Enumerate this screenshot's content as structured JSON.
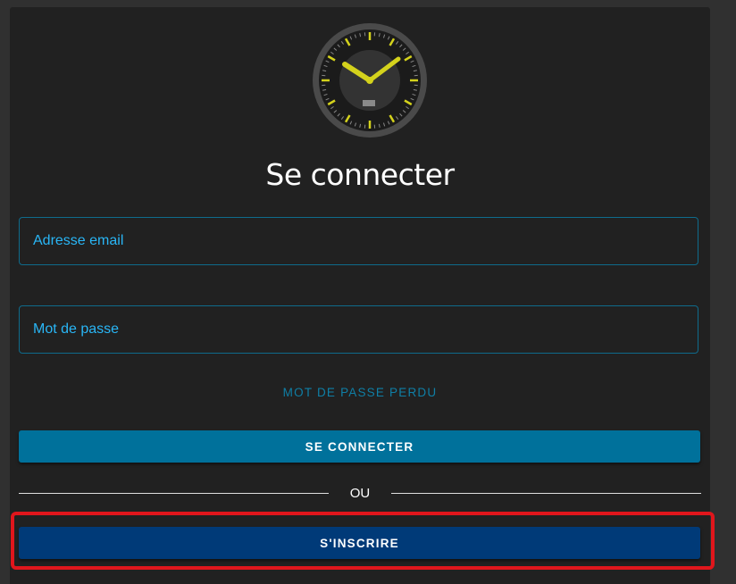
{
  "logo": {
    "icon": "clock-icon",
    "accent_color": "#d4d21c"
  },
  "title": "Se connecter",
  "form": {
    "email_placeholder": "Adresse email",
    "email_value": "",
    "password_placeholder": "Mot de passe",
    "password_value": ""
  },
  "forgot_password_label": "MOT DE PASSE PERDU",
  "login_button_label": "SE CONNECTER",
  "divider_label": "OU",
  "signup_button_label": "S'INSCRIRE",
  "colors": {
    "background": "#303030",
    "card": "#212121",
    "accent": "#29b6f6",
    "login_button": "#00719b",
    "signup_button": "#003a78",
    "highlight": "#e0161c"
  }
}
